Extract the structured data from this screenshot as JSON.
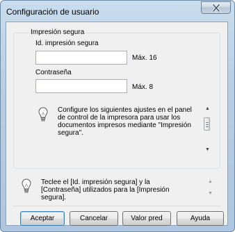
{
  "window": {
    "title": "Configuración de usuario",
    "close_glyph": "✕",
    "frame_color": "#b7cde4"
  },
  "group": {
    "label": "Impresión segura",
    "id_label": "Id. impresión segura",
    "id_value": "",
    "id_max": "Máx. 16",
    "password_label": "Contraseña",
    "password_value": "",
    "password_max": "Máx. 8",
    "note": "Configure los siguientes ajustes en el panel de control de la impresora para usar los documentos impresos mediante \"Impresión segura\".",
    "note_icon": "lightbulb-icon"
  },
  "hint": {
    "text": "Teclee el [Id. impresión segura] y la [Contraseña] utilizados para la [Impresión segura].",
    "icon": "lightbulb-icon"
  },
  "buttons": {
    "ok": "Aceptar",
    "cancel": "Cancelar",
    "default": "Valor pred",
    "help": "Ayuda"
  }
}
